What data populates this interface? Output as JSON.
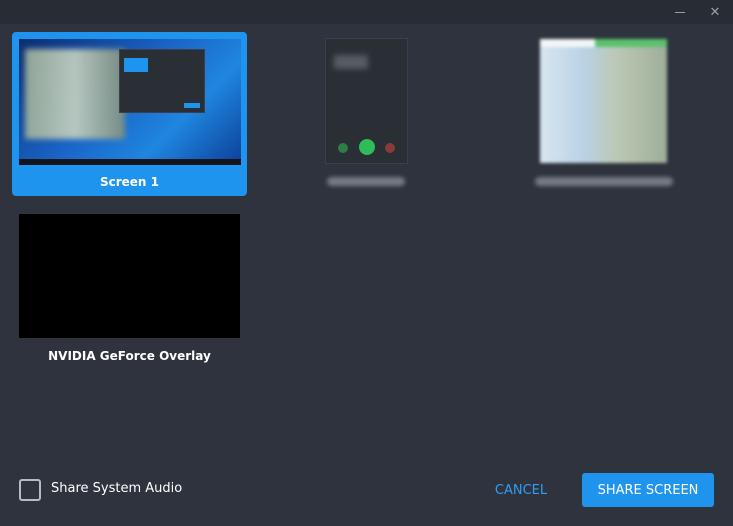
{
  "window": {
    "minimize_icon": "minimize-icon",
    "close_icon": "close-icon"
  },
  "sources": [
    {
      "label": "Screen 1",
      "selected": true,
      "thumbnail": "desktop-screenshot"
    },
    {
      "label": "",
      "selected": false,
      "thumbnail": "phone-call-window"
    },
    {
      "label": "",
      "selected": false,
      "thumbnail": "chat-app-window"
    },
    {
      "label": "NVIDIA GeForce Overlay",
      "selected": false,
      "thumbnail": "black"
    }
  ],
  "footer": {
    "audio_label": "Share System Audio",
    "audio_checked": false,
    "cancel_label": "CANCEL",
    "share_label": "SHARE SCREEN"
  },
  "colors": {
    "accent": "#1f94ee",
    "background": "#2e333d",
    "titlebar": "#282c34"
  }
}
